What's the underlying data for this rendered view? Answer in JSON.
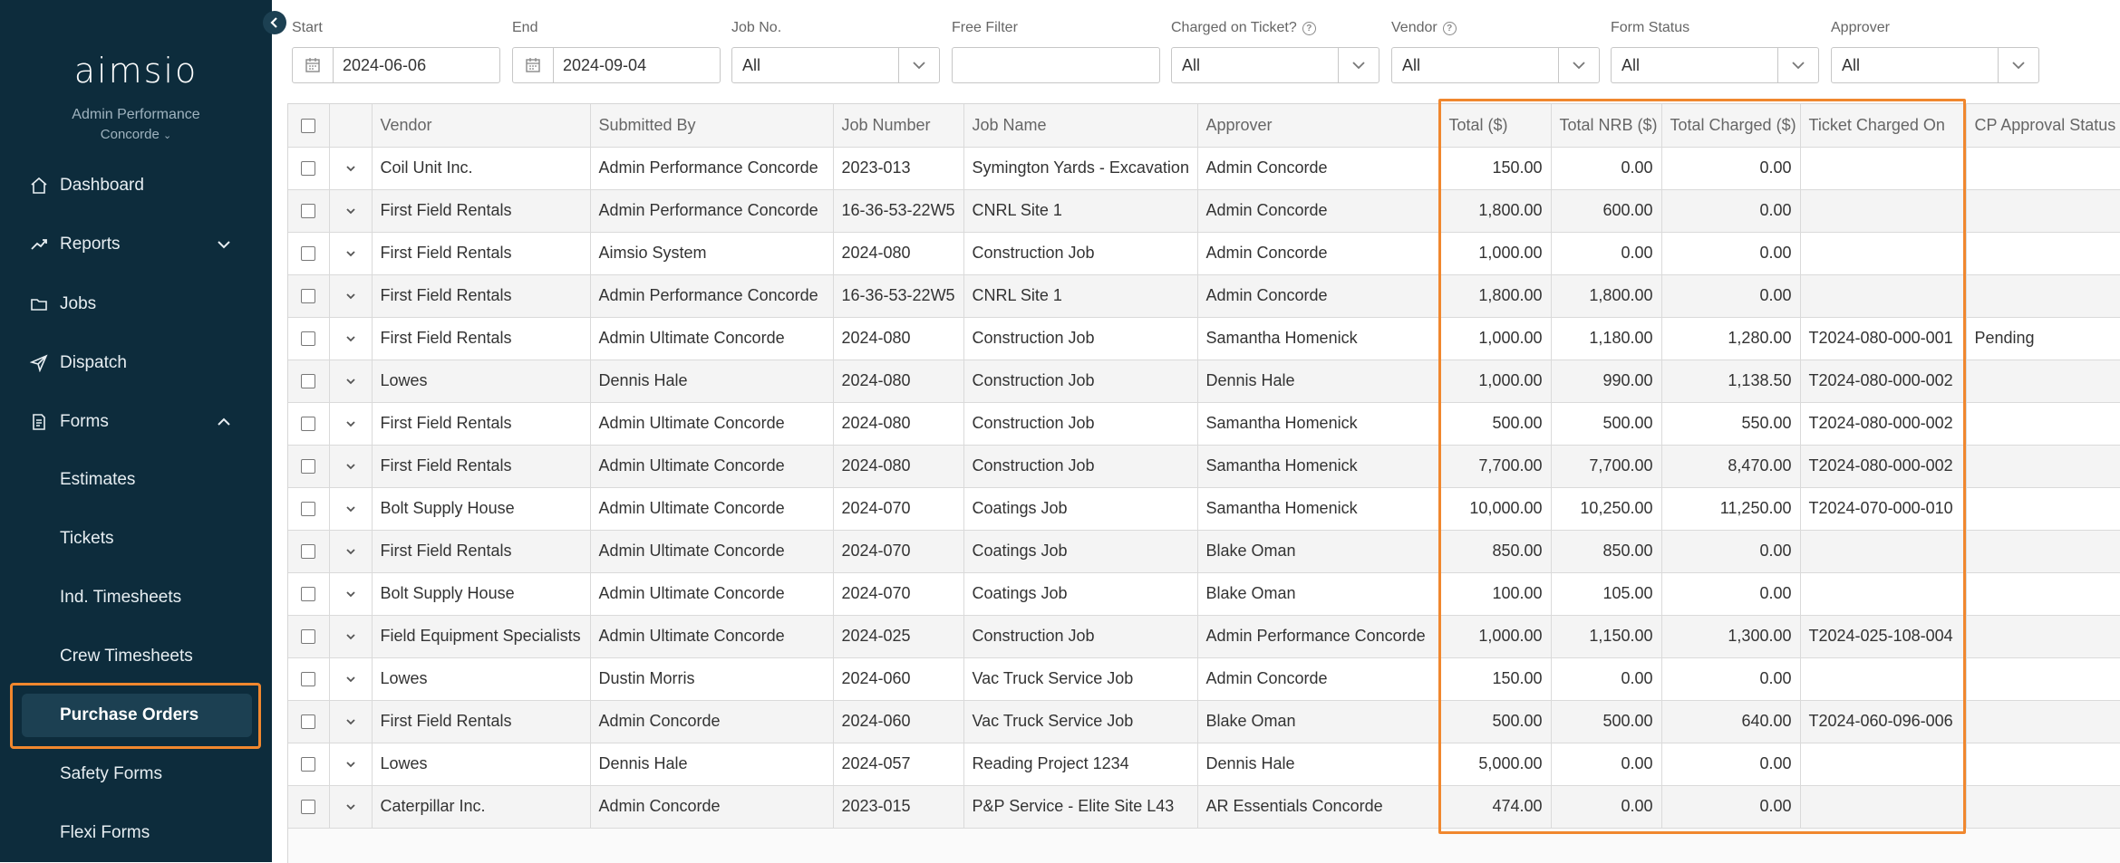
{
  "app": {
    "logo_text": "aimsio",
    "org_name": "Admin Performance",
    "org_location": "Concorde"
  },
  "sidebar": {
    "items": [
      {
        "label": "Dashboard",
        "icon": "home-icon"
      },
      {
        "label": "Reports",
        "icon": "trend-icon",
        "expanded": false
      },
      {
        "label": "Jobs",
        "icon": "folder-icon"
      },
      {
        "label": "Dispatch",
        "icon": "send-icon"
      },
      {
        "label": "Forms",
        "icon": "document-icon",
        "expanded": true
      }
    ],
    "form_items": [
      {
        "label": "Estimates"
      },
      {
        "label": "Tickets"
      },
      {
        "label": "Ind. Timesheets"
      },
      {
        "label": "Crew Timesheets"
      },
      {
        "label": "Purchase Orders",
        "active": true
      },
      {
        "label": "Safety Forms"
      },
      {
        "label": "Flexi Forms"
      }
    ]
  },
  "filters": {
    "start_label": "Start",
    "start_value": "2024-06-06",
    "end_label": "End",
    "end_value": "2024-09-04",
    "job_no_label": "Job No.",
    "job_no_value": "All",
    "free_filter_label": "Free Filter",
    "free_filter_value": "",
    "charged_label": "Charged on Ticket?",
    "charged_value": "All",
    "vendor_label": "Vendor",
    "vendor_value": "All",
    "form_status_label": "Form Status",
    "form_status_value": "All",
    "approver_label": "Approver",
    "approver_value": "All"
  },
  "table": {
    "columns": [
      "Vendor",
      "Submitted By",
      "Job Number",
      "Job Name",
      "Approver",
      "Total ($)",
      "Total NRB ($)",
      "Total Charged ($)",
      "Ticket Charged On",
      "CP Approval Status"
    ],
    "rows": [
      [
        "Coil Unit Inc.",
        "Admin Performance Concorde",
        "2023-013",
        "Symington Yards - Excavation",
        "Admin Concorde",
        "150.00",
        "0.00",
        "0.00",
        "",
        ""
      ],
      [
        "First Field Rentals",
        "Admin Performance Concorde",
        "16-36-53-22W5",
        "CNRL Site 1",
        "Admin Concorde",
        "1,800.00",
        "600.00",
        "0.00",
        "",
        ""
      ],
      [
        "First Field Rentals",
        "Aimsio System",
        "2024-080",
        "Construction Job",
        "Admin Concorde",
        "1,000.00",
        "0.00",
        "0.00",
        "",
        ""
      ],
      [
        "First Field Rentals",
        "Admin Performance Concorde",
        "16-36-53-22W5",
        "CNRL Site 1",
        "Admin Concorde",
        "1,800.00",
        "1,800.00",
        "0.00",
        "",
        ""
      ],
      [
        "First Field Rentals",
        "Admin Ultimate Concorde",
        "2024-080",
        "Construction Job",
        "Samantha Homenick",
        "1,000.00",
        "1,180.00",
        "1,280.00",
        "T2024-080-000-001",
        "Pending"
      ],
      [
        "Lowes",
        "Dennis Hale",
        "2024-080",
        "Construction Job",
        "Dennis Hale",
        "1,000.00",
        "990.00",
        "1,138.50",
        "T2024-080-000-002",
        ""
      ],
      [
        "First Field Rentals",
        "Admin Ultimate Concorde",
        "2024-080",
        "Construction Job",
        "Samantha Homenick",
        "500.00",
        "500.00",
        "550.00",
        "T2024-080-000-002",
        ""
      ],
      [
        "First Field Rentals",
        "Admin Ultimate Concorde",
        "2024-080",
        "Construction Job",
        "Samantha Homenick",
        "7,700.00",
        "7,700.00",
        "8,470.00",
        "T2024-080-000-002",
        ""
      ],
      [
        "Bolt Supply House",
        "Admin Ultimate Concorde",
        "2024-070",
        "Coatings Job",
        "Samantha Homenick",
        "10,000.00",
        "10,250.00",
        "11,250.00",
        "T2024-070-000-010",
        ""
      ],
      [
        "First Field Rentals",
        "Admin Ultimate Concorde",
        "2024-070",
        "Coatings Job",
        "Blake Oman",
        "850.00",
        "850.00",
        "0.00",
        "",
        ""
      ],
      [
        "Bolt Supply House",
        "Admin Ultimate Concorde",
        "2024-070",
        "Coatings Job",
        "Blake Oman",
        "100.00",
        "105.00",
        "0.00",
        "",
        ""
      ],
      [
        "Field Equipment Specialists",
        "Admin Ultimate Concorde",
        "2024-025",
        "Construction Job",
        "Admin Performance Concorde",
        "1,000.00",
        "1,150.00",
        "1,300.00",
        "T2024-025-108-004",
        ""
      ],
      [
        "Lowes",
        "Dustin Morris",
        "2024-060",
        "Vac Truck Service Job",
        "Admin Concorde",
        "150.00",
        "0.00",
        "0.00",
        "",
        ""
      ],
      [
        "First Field Rentals",
        "Admin Concorde",
        "2024-060",
        "Vac Truck Service Job",
        "Blake Oman",
        "500.00",
        "500.00",
        "640.00",
        "T2024-060-096-006",
        ""
      ],
      [
        "Lowes",
        "Dennis Hale",
        "2024-057",
        "Reading Project 1234",
        "Dennis Hale",
        "5,000.00",
        "0.00",
        "0.00",
        "",
        ""
      ],
      [
        "Caterpillar Inc.",
        "Admin Concorde",
        "2023-015",
        "P&P Service - Elite Site L43",
        "AR Essentials Concorde",
        "474.00",
        "0.00",
        "0.00",
        "",
        ""
      ]
    ]
  },
  "colors": {
    "sidebar_bg": "#0d2c3c",
    "highlight": "#f0872e"
  }
}
